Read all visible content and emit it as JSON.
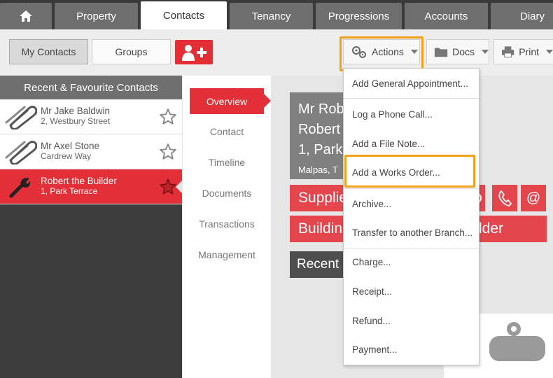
{
  "nav": {
    "home_icon": "home-icon",
    "tabs": [
      {
        "label": "Property"
      },
      {
        "label": "Contacts"
      },
      {
        "label": "Tenancy"
      },
      {
        "label": "Progressions"
      },
      {
        "label": "Accounts"
      },
      {
        "label": "Diary"
      }
    ],
    "active_tab": "Contacts"
  },
  "toolbar": {
    "my_contacts": "My Contacts",
    "groups": "Groups",
    "add_contact_icon": "add-contact-icon",
    "actions": "Actions",
    "docs": "Docs",
    "print": "Print"
  },
  "left_panel": {
    "header": "Recent & Favourite Contacts",
    "contacts": [
      {
        "name": "Mr Jake Baldwin",
        "address": "2, Westbury Street",
        "icon": "paperclip-icon",
        "favourite": false
      },
      {
        "name": "Mr Axel Stone",
        "address": "Cardrew Way",
        "icon": "paperclip-icon",
        "favourite": false
      },
      {
        "name": "Robert the Builder",
        "address": "1, Park Terrace",
        "icon": "wrench-icon",
        "favourite": true,
        "selected": true
      }
    ]
  },
  "subnav": {
    "items": [
      "Overview",
      "Contact",
      "Timeline",
      "Documents",
      "Transactions",
      "Management"
    ],
    "active": "Overview"
  },
  "main": {
    "name_line1": "Mr Rob",
    "name_line2": "Robert",
    "address_line": "1, Park",
    "town_line": "Malpas, T",
    "supplier_text": "Supplie",
    "building_text": "Buildin",
    "builder_tail": "lder",
    "recent_text": "Recent",
    "email_glyph": "@"
  },
  "dropdown": {
    "items": [
      "Add General Appointment...",
      "Log a Phone Call...",
      "Add a File Note...",
      "Add a Works Order...",
      "Archive...",
      "Transfer to another Branch...",
      "Charge...",
      "Receipt...",
      "Refund...",
      "Payment..."
    ]
  },
  "colors": {
    "brand_red": "#e32f37",
    "highlight_orange": "#f0a21b",
    "nav_grey": "#6e6e6e"
  }
}
